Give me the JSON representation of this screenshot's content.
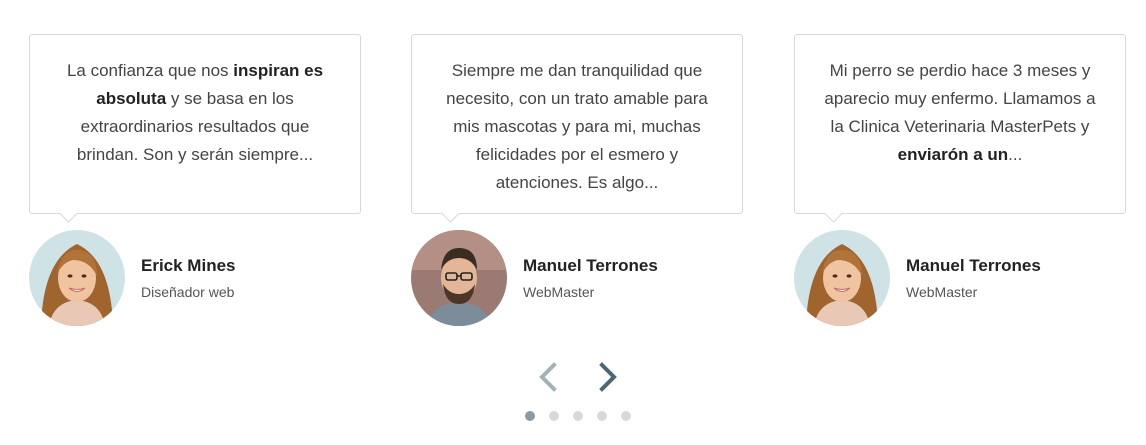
{
  "testimonials": [
    {
      "quote_parts": [
        "La confianza que nos ",
        "inspiran es absoluta",
        " y se basa en los extraordinarios resultados que brindan. Son y serán siempre..."
      ],
      "author": "Erick Mines",
      "role": "Diseñador web",
      "avatar_icon": "woman-portrait-icon"
    },
    {
      "quote_parts": [
        "Siempre me dan tranquilidad que necesito, con un trato amable para mis mascotas y para mi, muchas felicidades por el esmero y atenciones. Es algo...",
        "",
        ""
      ],
      "author": "Manuel Terrones",
      "role": "WebMaster",
      "avatar_icon": "man-portrait-icon"
    },
    {
      "quote_parts": [
        "Mi perro se perdio hace 3 meses y aparecio muy enfermo. Llamamos a la Clinica Veterinaria MasterPets y ",
        "enviarón a un",
        "..."
      ],
      "author": "Manuel Terrones",
      "role": "WebMaster",
      "avatar_icon": "woman-portrait-icon"
    }
  ],
  "navigation": {
    "prev_icon": "chevron-left-icon",
    "next_icon": "chevron-right-icon",
    "prev_color": "#a3b1b8",
    "next_color": "#4b6675"
  },
  "pagination": {
    "total": 5,
    "active_index": 0,
    "active_color": "#8d9aa1",
    "inactive_color": "#d9d9d9"
  }
}
